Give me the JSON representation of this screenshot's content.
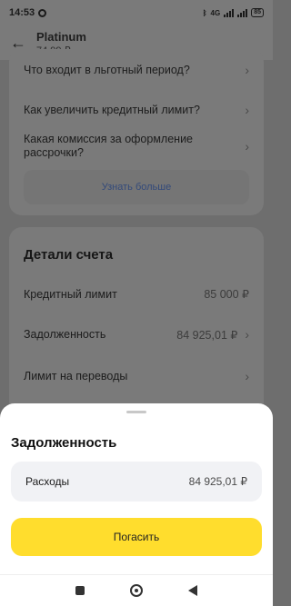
{
  "status_bar": {
    "time": "14:53",
    "network": "4G",
    "battery": "85"
  },
  "header": {
    "title": "Platinum",
    "subtitle": "74,99 ₽"
  },
  "faq": {
    "items": [
      {
        "label": "Что входит в льготный период?"
      },
      {
        "label": "Как увеличить кредитный лимит?"
      },
      {
        "label": "Какая комиссия за оформление рассрочки?"
      }
    ],
    "more_label": "Узнать больше"
  },
  "account_details": {
    "title": "Детали счета",
    "rows": [
      {
        "label": "Кредитный лимит",
        "value": "85 000 ₽"
      },
      {
        "label": "Задолженность",
        "value": "84 925,01 ₽"
      },
      {
        "label": "Лимит на переводы",
        "value": ""
      }
    ]
  },
  "sheet": {
    "title": "Задолженность",
    "expense_label": "Расходы",
    "expense_value": "84 925,01 ₽",
    "pay_label": "Погасить"
  },
  "colors": {
    "accent_yellow": "#ffdd2d",
    "scrim": "#6e6e6e"
  }
}
